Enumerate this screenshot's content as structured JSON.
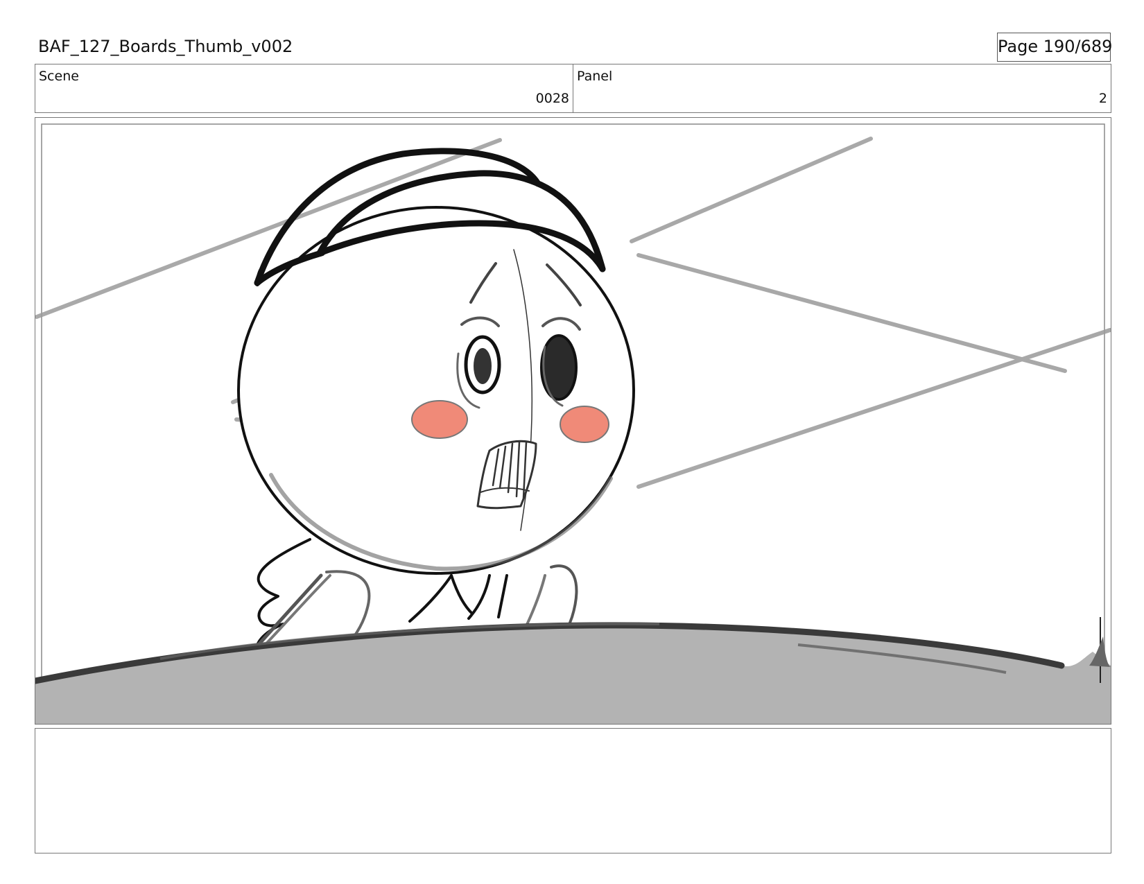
{
  "header": {
    "title": "BAF_127_Boards_Thumb_v002",
    "page": "Page 190/689"
  },
  "info": {
    "scene_label": "Scene",
    "scene_value": "0028",
    "panel_label": "Panel",
    "panel_value": "2"
  },
  "notes": {
    "text": ""
  },
  "colors": {
    "ink": "#111111",
    "pencil": "#9a9a9a",
    "blush": "#f08a78",
    "foreground": "#b3b3b3",
    "border": "#777777"
  }
}
